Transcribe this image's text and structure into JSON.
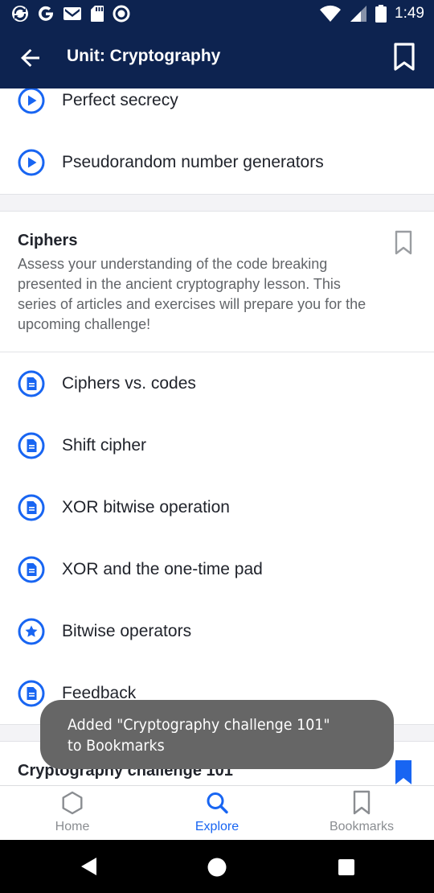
{
  "status_bar": {
    "time": "1:49",
    "left_icons": [
      "sync-icon",
      "google-icon",
      "gmail-icon",
      "sd-card-icon",
      "circle-app-icon"
    ],
    "right_icons": [
      "wifi-icon",
      "signal-icon",
      "battery-icon"
    ]
  },
  "app_bar": {
    "title": "Unit: Cryptography",
    "back_icon": "arrow-left-icon",
    "bookmark_icon": "bookmark-outline-icon"
  },
  "top_items": [
    {
      "label": "Perfect secrecy",
      "icon": "play-circle-icon"
    },
    {
      "label": "Pseudorandom number generators",
      "icon": "play-circle-icon"
    }
  ],
  "section": {
    "title": "Ciphers",
    "description": "Assess your understanding of the code breaking presented in the ancient cryptography lesson. This series of articles and exercises will prepare you for the upcoming challenge!",
    "items": [
      {
        "label": "Ciphers vs. codes",
        "icon": "article-icon"
      },
      {
        "label": "Shift cipher",
        "icon": "article-icon"
      },
      {
        "label": "XOR bitwise operation",
        "icon": "article-icon"
      },
      {
        "label": "XOR and the one-time pad",
        "icon": "article-icon"
      },
      {
        "label": "Bitwise operators",
        "icon": "star-circle-icon"
      },
      {
        "label": "Feedback",
        "icon": "article-icon"
      }
    ]
  },
  "next_section": {
    "title": "Cryptography challenge 101",
    "bookmarked": true
  },
  "toast": {
    "line1": "Added \"Cryptography challenge 101\"",
    "line2": "to Bookmarks"
  },
  "bottom_nav": [
    {
      "label": "Home",
      "icon": "hexagon-icon",
      "active": false
    },
    {
      "label": "Explore",
      "icon": "search-icon",
      "active": true
    },
    {
      "label": "Bookmarks",
      "icon": "bookmark-outline-icon",
      "active": false
    }
  ],
  "colors": {
    "header": "#0d2350",
    "accent": "#1865f2",
    "toast": "#666666",
    "muted": "#8a8d91"
  }
}
